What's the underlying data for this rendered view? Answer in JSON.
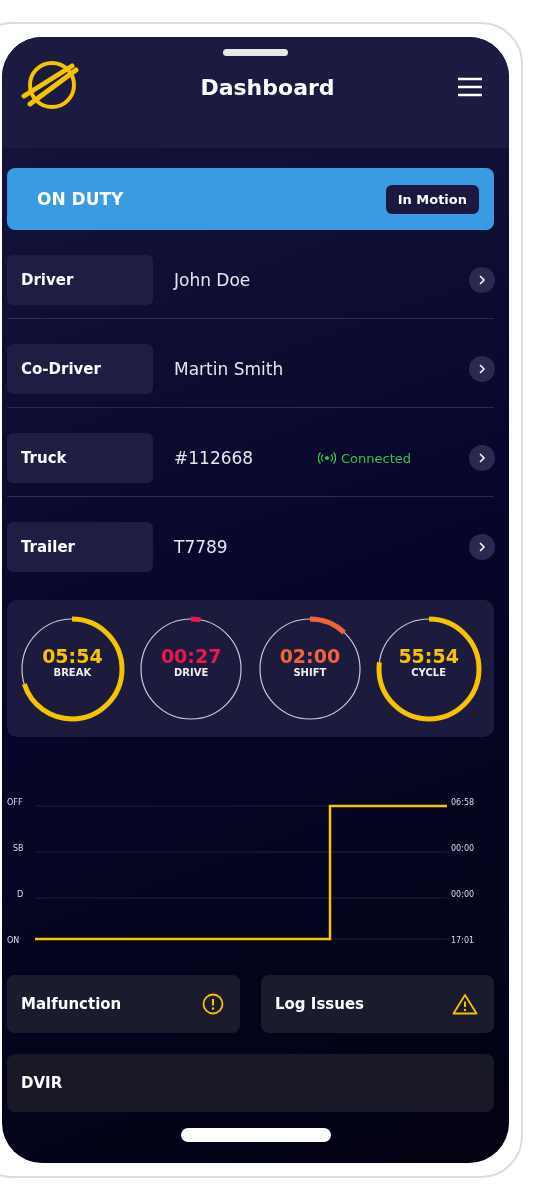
{
  "header": {
    "title": "Dashboard"
  },
  "duty_status": {
    "label": "ON DUTY",
    "badge": "In Motion"
  },
  "info_rows": [
    {
      "label": "Driver",
      "value": "John Doe"
    },
    {
      "label": "Co-Driver",
      "value": "Martin Smith"
    },
    {
      "label": "Truck",
      "value": "#112668",
      "status": "Connected"
    },
    {
      "label": "Trailer",
      "value": "T7789"
    }
  ],
  "timers": [
    {
      "time": "05:54",
      "label": "BREAK",
      "level": 0.7,
      "color": "#f5c400"
    },
    {
      "time": "00:27",
      "label": "DRIVE",
      "level": 0.03,
      "color": "#e8194e"
    },
    {
      "time": "02:00",
      "label": "SHIFT",
      "level": 0.12,
      "color": "#f0643a"
    },
    {
      "time": "55:54",
      "label": "CYCLE",
      "level": 0.77,
      "color": "#f5c400"
    }
  ],
  "log_graph": {
    "status_labels": [
      "OFF",
      "SB",
      "D",
      "ON"
    ],
    "totals": [
      "06:58",
      "00:00",
      "00:00",
      "17:01"
    ]
  },
  "alerts": [
    {
      "label": "Malfunction",
      "kind": "circle"
    },
    {
      "label": "Log Issues",
      "kind": "triangle"
    }
  ],
  "dvir": {
    "label": "DVIR"
  }
}
